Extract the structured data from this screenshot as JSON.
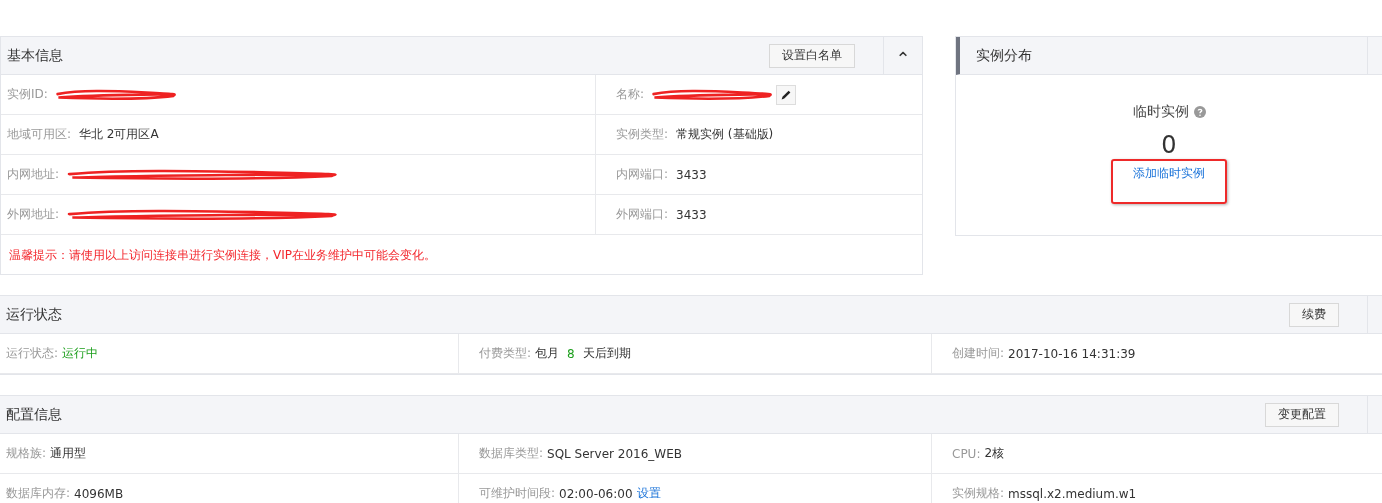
{
  "basic_info": {
    "title": "基本信息",
    "whitelist_button": "设置白名单",
    "collapse_icon": "⌃",
    "rows": [
      {
        "cells": [
          {
            "label": "实例ID:",
            "kind": "redacted"
          },
          {
            "label": "名称:",
            "kind": "redacted",
            "editable": true
          }
        ]
      },
      {
        "cells": [
          {
            "label": "地域可用区:",
            "kind": "text",
            "value": "华北 2可用区A"
          },
          {
            "label": "实例类型:",
            "kind": "text",
            "value": "常规实例 (基础版)"
          }
        ]
      },
      {
        "cells": [
          {
            "label": "内网地址:",
            "kind": "redacted",
            "long": true
          },
          {
            "label": "内网端口:",
            "kind": "text",
            "value": "3433"
          }
        ]
      },
      {
        "cells": [
          {
            "label": "外网地址:",
            "kind": "redacted",
            "long": true
          },
          {
            "label": "外网端口:",
            "kind": "text",
            "value": "3433"
          }
        ]
      }
    ],
    "warning": "温馨提示：请使用以上访问连接串进行实例连接，VIP在业务维护中可能会变化。"
  },
  "distribution": {
    "title": "实例分布",
    "metric_label": "临时实例",
    "metric_value": "0",
    "add_link": "添加临时实例",
    "link_highlighted": true
  },
  "run_status": {
    "title": "运行状态",
    "renew_button": "续费",
    "cells": [
      {
        "label": "运行状态:",
        "parts": [
          {
            "text": "运行中",
            "kind": "status"
          }
        ]
      },
      {
        "label": "付费类型:",
        "parts": [
          {
            "text": "包月",
            "kind": "plain"
          },
          {
            "text": "8",
            "kind": "status"
          },
          {
            "text": "天后到期",
            "kind": "plain"
          }
        ]
      },
      {
        "label": "创建时间:",
        "parts": [
          {
            "text": "2017-10-16 14:31:39",
            "kind": "plain"
          }
        ]
      }
    ]
  },
  "config": {
    "title": "配置信息",
    "change_button": "变更配置",
    "rows": [
      {
        "cells": [
          {
            "label": "规格族:",
            "value": "通用型"
          },
          {
            "label": "数据库类型:",
            "value": "SQL Server 2016_WEB"
          },
          {
            "label": "CPU:",
            "value": "2核"
          }
        ]
      },
      {
        "cells": [
          {
            "label": "数据库内存:",
            "value": "4096MB"
          },
          {
            "label": "可维护时间段:",
            "value": "02:00-06:00",
            "link": "设置"
          },
          {
            "label": "实例规格:",
            "value": "mssql.x2.medium.w1"
          }
        ]
      }
    ]
  }
}
